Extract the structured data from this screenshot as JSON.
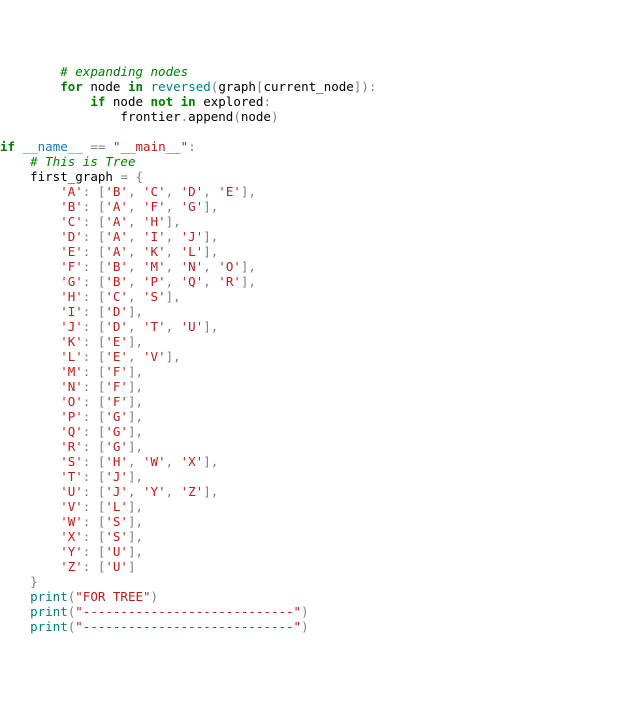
{
  "code": {
    "lines": [
      [
        [
          "sp",
          "        "
        ],
        [
          "cm",
          "# expanding nodes"
        ]
      ],
      [
        [
          "sp",
          "        "
        ],
        [
          "kw",
          "for"
        ],
        [
          "sp",
          " "
        ],
        [
          "nm",
          "node"
        ],
        [
          "sp",
          " "
        ],
        [
          "kw",
          "in"
        ],
        [
          "sp",
          " "
        ],
        [
          "fn",
          "reversed"
        ],
        [
          "op",
          "("
        ],
        [
          "nm",
          "graph"
        ],
        [
          "op",
          "["
        ],
        [
          "nm",
          "current_node"
        ],
        [
          "op",
          "]):"
        ]
      ],
      [
        [
          "sp",
          "            "
        ],
        [
          "kw",
          "if"
        ],
        [
          "sp",
          " "
        ],
        [
          "nm",
          "node"
        ],
        [
          "sp",
          " "
        ],
        [
          "kw",
          "not in"
        ],
        [
          "sp",
          " "
        ],
        [
          "nm",
          "explored"
        ],
        [
          "op",
          ":"
        ]
      ],
      [
        [
          "sp",
          "                "
        ],
        [
          "nm",
          "frontier"
        ],
        [
          "op",
          "."
        ],
        [
          "nm",
          "append"
        ],
        [
          "op",
          "("
        ],
        [
          "nm",
          "node"
        ],
        [
          "op",
          ")"
        ]
      ],
      [
        [
          "sp",
          ""
        ]
      ],
      [
        [
          "kw",
          "if"
        ],
        [
          "sp",
          " "
        ],
        [
          "dun",
          "__name__"
        ],
        [
          "sp",
          " "
        ],
        [
          "op",
          "=="
        ],
        [
          "sp",
          " "
        ],
        [
          "str",
          "\"__main__\""
        ],
        [
          "op",
          ":"
        ]
      ],
      [
        [
          "sp",
          "    "
        ],
        [
          "cm",
          "# This is Tree"
        ]
      ],
      [
        [
          "sp",
          "    "
        ],
        [
          "nm",
          "first_graph"
        ],
        [
          "sp",
          " "
        ],
        [
          "op",
          "="
        ],
        [
          "sp",
          " "
        ],
        [
          "op",
          "{"
        ]
      ],
      [
        [
          "sp",
          "        "
        ],
        [
          "str",
          "'A'"
        ],
        [
          "op",
          ": ["
        ],
        [
          "str",
          "'B'"
        ],
        [
          "op",
          ", "
        ],
        [
          "str",
          "'C'"
        ],
        [
          "op",
          ", "
        ],
        [
          "str",
          "'D'"
        ],
        [
          "op",
          ", "
        ],
        [
          "str",
          "'E'"
        ],
        [
          "op",
          "],"
        ]
      ],
      [
        [
          "sp",
          "        "
        ],
        [
          "str",
          "'B'"
        ],
        [
          "op",
          ": ["
        ],
        [
          "str",
          "'A'"
        ],
        [
          "op",
          ", "
        ],
        [
          "str",
          "'F'"
        ],
        [
          "op",
          ", "
        ],
        [
          "str",
          "'G'"
        ],
        [
          "op",
          "],"
        ]
      ],
      [
        [
          "sp",
          "        "
        ],
        [
          "str",
          "'C'"
        ],
        [
          "op",
          ": ["
        ],
        [
          "str",
          "'A'"
        ],
        [
          "op",
          ", "
        ],
        [
          "str",
          "'H'"
        ],
        [
          "op",
          "],"
        ]
      ],
      [
        [
          "sp",
          "        "
        ],
        [
          "str",
          "'D'"
        ],
        [
          "op",
          ": ["
        ],
        [
          "str",
          "'A'"
        ],
        [
          "op",
          ", "
        ],
        [
          "str",
          "'I'"
        ],
        [
          "op",
          ", "
        ],
        [
          "str",
          "'J'"
        ],
        [
          "op",
          "],"
        ]
      ],
      [
        [
          "sp",
          "        "
        ],
        [
          "str",
          "'E'"
        ],
        [
          "op",
          ": ["
        ],
        [
          "str",
          "'A'"
        ],
        [
          "op",
          ", "
        ],
        [
          "str",
          "'K'"
        ],
        [
          "op",
          ", "
        ],
        [
          "str",
          "'L'"
        ],
        [
          "op",
          "],"
        ]
      ],
      [
        [
          "sp",
          "        "
        ],
        [
          "str",
          "'F'"
        ],
        [
          "op",
          ": ["
        ],
        [
          "str",
          "'B'"
        ],
        [
          "op",
          ", "
        ],
        [
          "str",
          "'M'"
        ],
        [
          "op",
          ", "
        ],
        [
          "str",
          "'N'"
        ],
        [
          "op",
          ", "
        ],
        [
          "str",
          "'O'"
        ],
        [
          "op",
          "],"
        ]
      ],
      [
        [
          "sp",
          "        "
        ],
        [
          "str",
          "'G'"
        ],
        [
          "op",
          ": ["
        ],
        [
          "str",
          "'B'"
        ],
        [
          "op",
          ", "
        ],
        [
          "str",
          "'P'"
        ],
        [
          "op",
          ", "
        ],
        [
          "str",
          "'Q'"
        ],
        [
          "op",
          ", "
        ],
        [
          "str",
          "'R'"
        ],
        [
          "op",
          "],"
        ]
      ],
      [
        [
          "sp",
          "        "
        ],
        [
          "str",
          "'H'"
        ],
        [
          "op",
          ": ["
        ],
        [
          "str",
          "'C'"
        ],
        [
          "op",
          ", "
        ],
        [
          "str",
          "'S'"
        ],
        [
          "op",
          "],"
        ]
      ],
      [
        [
          "sp",
          "        "
        ],
        [
          "str",
          "'I'"
        ],
        [
          "op",
          ": ["
        ],
        [
          "str",
          "'D'"
        ],
        [
          "op",
          "],"
        ]
      ],
      [
        [
          "sp",
          "        "
        ],
        [
          "str",
          "'J'"
        ],
        [
          "op",
          ": ["
        ],
        [
          "str",
          "'D'"
        ],
        [
          "op",
          ", "
        ],
        [
          "str",
          "'T'"
        ],
        [
          "op",
          ", "
        ],
        [
          "str",
          "'U'"
        ],
        [
          "op",
          "],"
        ]
      ],
      [
        [
          "sp",
          "        "
        ],
        [
          "str",
          "'K'"
        ],
        [
          "op",
          ": ["
        ],
        [
          "str",
          "'E'"
        ],
        [
          "op",
          "],"
        ]
      ],
      [
        [
          "sp",
          "        "
        ],
        [
          "str",
          "'L'"
        ],
        [
          "op",
          ": ["
        ],
        [
          "str",
          "'E'"
        ],
        [
          "op",
          ", "
        ],
        [
          "str",
          "'V'"
        ],
        [
          "op",
          "],"
        ]
      ],
      [
        [
          "sp",
          "        "
        ],
        [
          "str",
          "'M'"
        ],
        [
          "op",
          ": ["
        ],
        [
          "str",
          "'F'"
        ],
        [
          "op",
          "],"
        ]
      ],
      [
        [
          "sp",
          "        "
        ],
        [
          "str",
          "'N'"
        ],
        [
          "op",
          ": ["
        ],
        [
          "str",
          "'F'"
        ],
        [
          "op",
          "],"
        ]
      ],
      [
        [
          "sp",
          "        "
        ],
        [
          "str",
          "'O'"
        ],
        [
          "op",
          ": ["
        ],
        [
          "str",
          "'F'"
        ],
        [
          "op",
          "],"
        ]
      ],
      [
        [
          "sp",
          "        "
        ],
        [
          "str",
          "'P'"
        ],
        [
          "op",
          ": ["
        ],
        [
          "str",
          "'G'"
        ],
        [
          "op",
          "],"
        ]
      ],
      [
        [
          "sp",
          "        "
        ],
        [
          "str",
          "'Q'"
        ],
        [
          "op",
          ": ["
        ],
        [
          "str",
          "'G'"
        ],
        [
          "op",
          "],"
        ]
      ],
      [
        [
          "sp",
          "        "
        ],
        [
          "str",
          "'R'"
        ],
        [
          "op",
          ": ["
        ],
        [
          "str",
          "'G'"
        ],
        [
          "op",
          "],"
        ]
      ],
      [
        [
          "sp",
          "        "
        ],
        [
          "str",
          "'S'"
        ],
        [
          "op",
          ": ["
        ],
        [
          "str",
          "'H'"
        ],
        [
          "op",
          ", "
        ],
        [
          "str",
          "'W'"
        ],
        [
          "op",
          ", "
        ],
        [
          "str",
          "'X'"
        ],
        [
          "op",
          "],"
        ]
      ],
      [
        [
          "sp",
          "        "
        ],
        [
          "str",
          "'T'"
        ],
        [
          "op",
          ": ["
        ],
        [
          "str",
          "'J'"
        ],
        [
          "op",
          "],"
        ]
      ],
      [
        [
          "sp",
          "        "
        ],
        [
          "str",
          "'U'"
        ],
        [
          "op",
          ": ["
        ],
        [
          "str",
          "'J'"
        ],
        [
          "op",
          ", "
        ],
        [
          "str",
          "'Y'"
        ],
        [
          "op",
          ", "
        ],
        [
          "str",
          "'Z'"
        ],
        [
          "op",
          "],"
        ]
      ],
      [
        [
          "sp",
          "        "
        ],
        [
          "str",
          "'V'"
        ],
        [
          "op",
          ": ["
        ],
        [
          "str",
          "'L'"
        ],
        [
          "op",
          "],"
        ]
      ],
      [
        [
          "sp",
          "        "
        ],
        [
          "str",
          "'W'"
        ],
        [
          "op",
          ": ["
        ],
        [
          "str",
          "'S'"
        ],
        [
          "op",
          "],"
        ]
      ],
      [
        [
          "sp",
          "        "
        ],
        [
          "str",
          "'X'"
        ],
        [
          "op",
          ": ["
        ],
        [
          "str",
          "'S'"
        ],
        [
          "op",
          "],"
        ]
      ],
      [
        [
          "sp",
          "        "
        ],
        [
          "str",
          "'Y'"
        ],
        [
          "op",
          ": ["
        ],
        [
          "str",
          "'U'"
        ],
        [
          "op",
          "],"
        ]
      ],
      [
        [
          "sp",
          "        "
        ],
        [
          "str",
          "'Z'"
        ],
        [
          "op",
          ": ["
        ],
        [
          "str",
          "'U'"
        ],
        [
          "op",
          "]"
        ]
      ],
      [
        [
          "sp",
          "    "
        ],
        [
          "op",
          "}"
        ]
      ],
      [
        [
          "sp",
          "    "
        ],
        [
          "builtin",
          "print"
        ],
        [
          "op",
          "("
        ],
        [
          "str",
          "\"FOR TREE\""
        ],
        [
          "op",
          ")"
        ]
      ],
      [
        [
          "sp",
          "    "
        ],
        [
          "builtin",
          "print"
        ],
        [
          "op",
          "("
        ],
        [
          "str",
          "\"----------------------------\""
        ],
        [
          "op",
          ")"
        ]
      ],
      [
        [
          "sp",
          "    "
        ],
        [
          "builtin",
          "print"
        ],
        [
          "op",
          "("
        ],
        [
          "str",
          "\"----------------------------\""
        ],
        [
          "op",
          ")"
        ]
      ]
    ]
  }
}
